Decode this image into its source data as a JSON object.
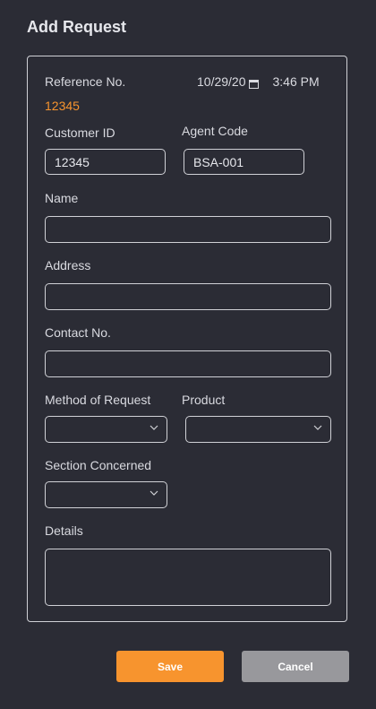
{
  "dialog": {
    "title": "Add Request"
  },
  "reference": {
    "label": "Reference No.",
    "value": "12345",
    "date": "10/29/20",
    "time": "3:46 PM"
  },
  "fields": {
    "customer_id": {
      "label": "Customer ID",
      "value": "12345"
    },
    "agent_code": {
      "label": "Agent Code",
      "value": "BSA-001"
    },
    "name": {
      "label": "Name",
      "value": ""
    },
    "address": {
      "label": "Address",
      "value": ""
    },
    "contact_no": {
      "label": "Contact No.",
      "value": ""
    },
    "method_of_request": {
      "label": "Method of Request",
      "value": ""
    },
    "product": {
      "label": "Product",
      "value": ""
    },
    "section_concerned": {
      "label": "Section Concerned",
      "value": ""
    },
    "details": {
      "label": "Details",
      "value": ""
    }
  },
  "actions": {
    "save_label": "Save",
    "cancel_label": "Cancel"
  },
  "colors": {
    "background": "#2b2c35",
    "accent": "#f7942e",
    "cancel": "#98989c"
  },
  "icons": {
    "date": "calendar-icon",
    "dropdown": "chevron-down-icon"
  }
}
